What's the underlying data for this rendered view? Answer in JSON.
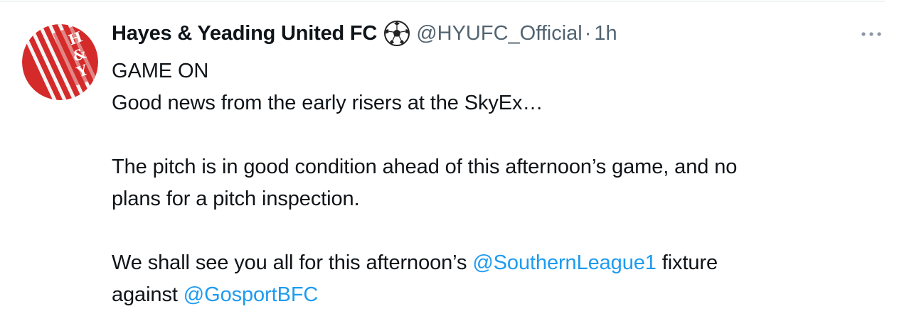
{
  "tweet": {
    "author": {
      "display_name": "Hayes & Yeading United FC",
      "badge_icon": "soccer-ball-icon",
      "handle": "@HYUFC_Official",
      "separator": "·",
      "timestamp": "1h",
      "avatar_letters": [
        "H",
        "&",
        "Y"
      ]
    },
    "menu_icon": "more-horizontal-icon",
    "text": {
      "line1": "GAME ON",
      "line2": "Good news from the early risers at the SkyEx…",
      "line3": "The pitch is in good condition ahead of this afternoon’s game, and no",
      "line4": "plans for a pitch inspection.",
      "line5_before": "We shall see you all for this afternoon’s ",
      "line5_mention": "@SouthernLeague1",
      "line5_after": " fixture",
      "line6_before": "against ",
      "line6_mention": "@GosportBFC"
    }
  },
  "colors": {
    "text_primary": "#0f1419",
    "text_secondary": "#536471",
    "link": "#1d9bf0",
    "avatar_red": "#d42a2a",
    "divider": "#eff3f4"
  }
}
